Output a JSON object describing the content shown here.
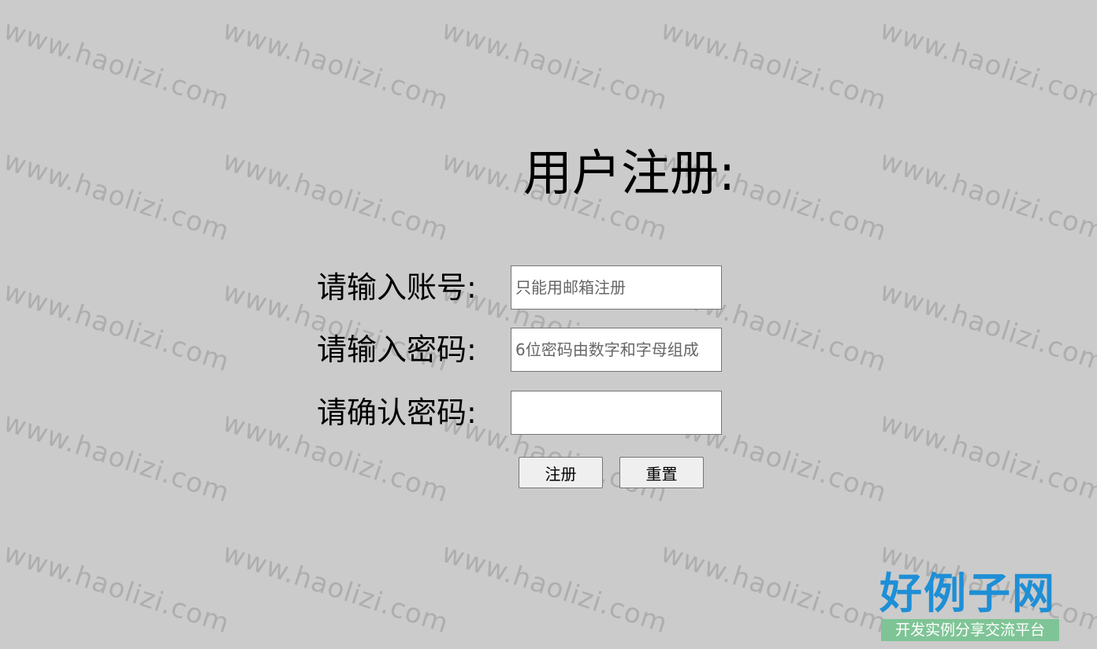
{
  "watermark": {
    "text": "www.haolizi.com"
  },
  "form": {
    "title": "用户注册:",
    "account_label": "请输入账号:",
    "account_placeholder": "只能用邮箱注册",
    "account_value": "",
    "password_label": "请输入密码:",
    "password_placeholder": "6位密码由数字和字母组成",
    "password_value": "",
    "confirm_label": "请确认密码:",
    "confirm_placeholder": "",
    "confirm_value": "",
    "register_button": "注册",
    "reset_button": "重置"
  },
  "logo": {
    "main_text": "好例子网",
    "sub_text": "开发实例分享交流平台",
    "main_color": "#1e8fd6",
    "sub_bg_color": "#7fc496"
  },
  "colors": {
    "background": "#cbcbcb"
  }
}
